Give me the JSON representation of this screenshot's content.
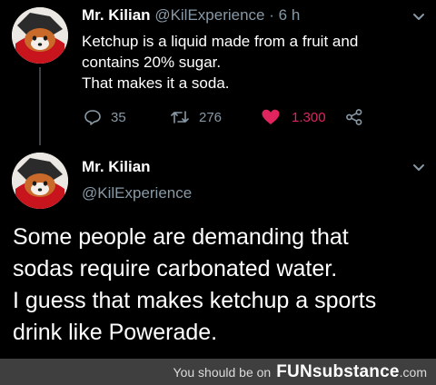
{
  "tweet_1": {
    "name": "Mr. Kilian",
    "handle": "@KilExperience",
    "separator": "·",
    "time": "6 h",
    "text_lines": [
      "Ketchup is a liquid made from a fruit and",
      "contains 20% sugar.",
      "That makes it a soda."
    ],
    "actions": {
      "reply_count": "35",
      "retweet_count": "276",
      "like_count": "1.300"
    }
  },
  "tweet_2": {
    "name": "Mr. Kilian",
    "handle": "@KilExperience",
    "text_lines": [
      "Some people are demanding that",
      "sodas require carbonated water.",
      "I guess that makes ketchup a sports",
      "drink like Powerade."
    ]
  },
  "footer": {
    "prefix": "You should be on",
    "brand": "FUNsubstance",
    "tld": ".com"
  },
  "colors": {
    "background": "#000000",
    "muted_text": "#8899a6",
    "like_accent": "#e0245e",
    "footer_bg": "#3f3f3f"
  },
  "icons": [
    "avatar-red-panda",
    "chevron-down-icon",
    "reply-icon",
    "retweet-icon",
    "heart-icon",
    "share-icon"
  ]
}
